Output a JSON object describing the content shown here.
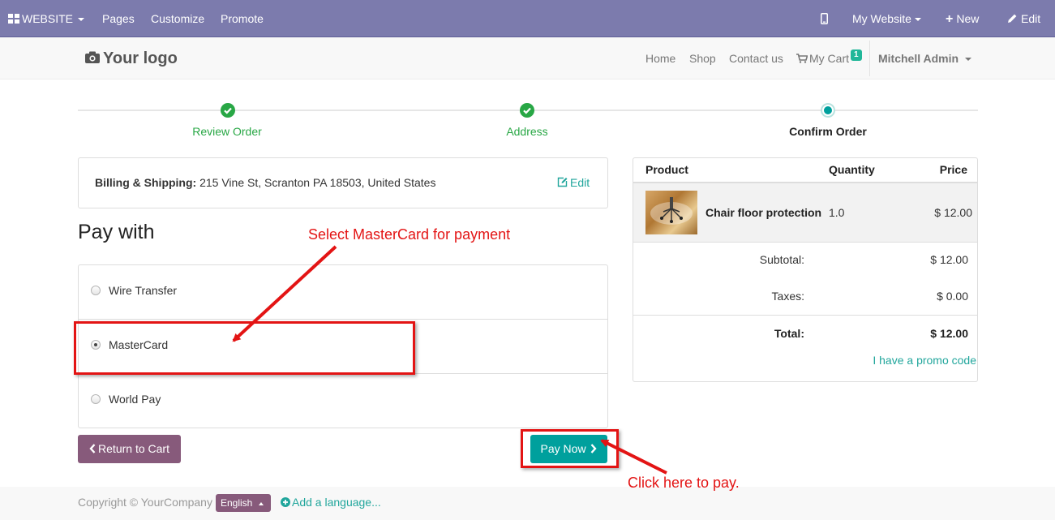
{
  "topbar": {
    "website_label": "WEBSITE",
    "pages_label": "Pages",
    "customize_label": "Customize",
    "promote_label": "Promote",
    "my_website_label": "My Website",
    "new_label": "New",
    "edit_label": "Edit"
  },
  "navbar": {
    "logo_text": "Your logo",
    "home": "Home",
    "shop": "Shop",
    "contact": "Contact us",
    "cart": "My Cart",
    "cart_count": "1",
    "user": "Mitchell Admin"
  },
  "wizard": {
    "steps": [
      {
        "label": "Review Order",
        "state": "done"
      },
      {
        "label": "Address",
        "state": "done"
      },
      {
        "label": "Confirm Order",
        "state": "active"
      }
    ]
  },
  "billing": {
    "label": "Billing & Shipping:",
    "address": "215 Vine St, Scranton PA 18503, United States",
    "edit_label": "Edit"
  },
  "payment": {
    "heading": "Pay with",
    "options": [
      {
        "label": "Wire Transfer",
        "selected": false
      },
      {
        "label": "MasterCard",
        "selected": true
      },
      {
        "label": "World Pay",
        "selected": false
      }
    ]
  },
  "buttons": {
    "return_label": "Return to Cart",
    "pay_label": "Pay Now"
  },
  "cart": {
    "headers": {
      "product": "Product",
      "quantity": "Quantity",
      "price": "Price"
    },
    "items": [
      {
        "name": "Chair floor protection",
        "quantity": "1.0",
        "price": "$ 12.00"
      }
    ],
    "subtotal_label": "Subtotal:",
    "subtotal": "$ 12.00",
    "taxes_label": "Taxes:",
    "taxes": "$ 0.00",
    "total_label": "Total:",
    "total": "$ 12.00",
    "promo_label": "I have a promo code"
  },
  "annotations": {
    "select_note": "Select MasterCard for payment",
    "pay_note": "Click here to pay."
  },
  "footer": {
    "copyright": "Copyright © YourCompany",
    "language": "English",
    "add_language": "Add a language..."
  },
  "colors": {
    "topbar": "#7c7bad",
    "accent": "#21a69c",
    "success": "#28a745",
    "return_button": "#875a7b",
    "annotation": "#e31414"
  }
}
